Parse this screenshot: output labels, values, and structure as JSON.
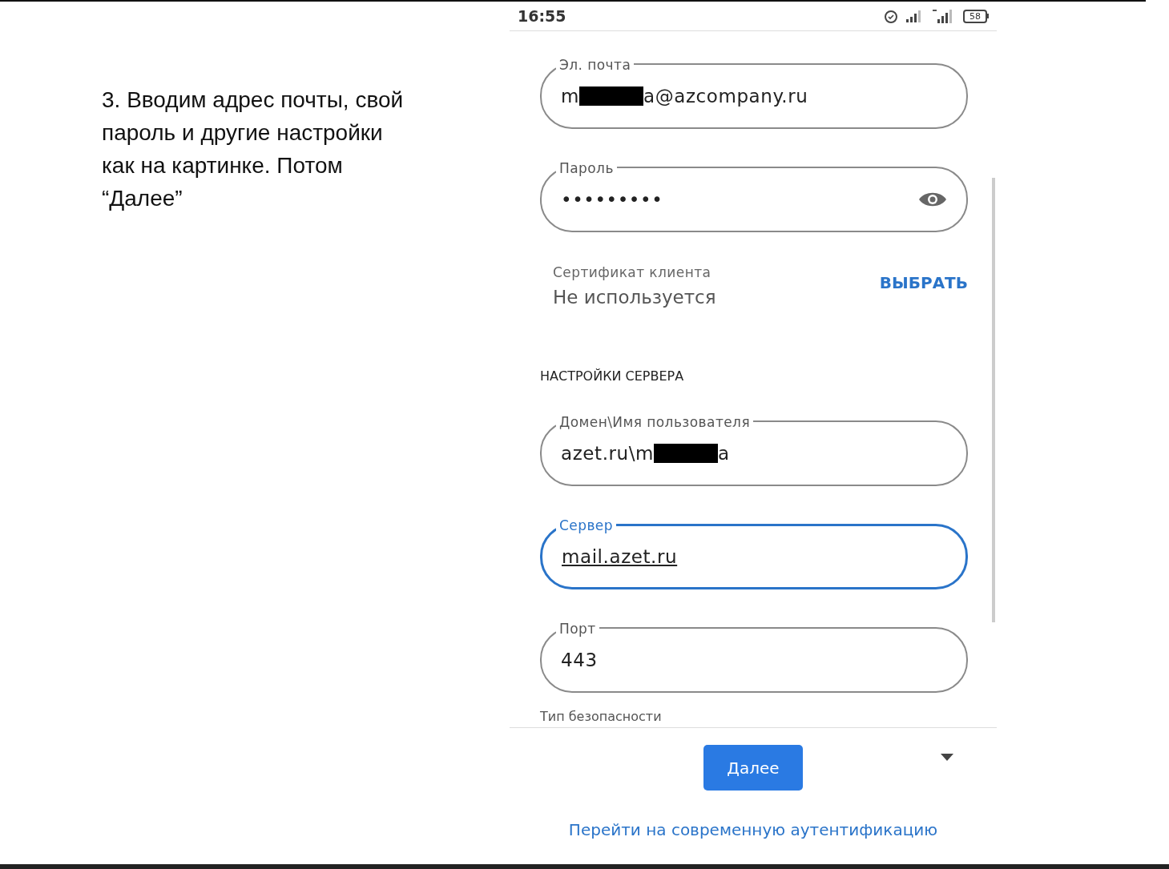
{
  "instruction": [
    "3. Вводим адрес почты, свой",
    "пароль и другие настройки",
    "как на картинке. Потом",
    "“Далее”"
  ],
  "status_bar": {
    "time": "16:55",
    "battery": "58"
  },
  "fields": [
    {
      "kind": "text",
      "label": "Эл. почта",
      "value_before": "m",
      "value_after": "a@azcompany.ru",
      "redacted": true,
      "focused": false
    },
    {
      "kind": "password",
      "label": "Пароль",
      "value_before": "•••••••••",
      "redacted": false,
      "focused": false
    }
  ],
  "certificate": {
    "label": "Сертификат клиента",
    "value": "Не используется",
    "action": "ВЫБРАТЬ"
  },
  "server_section": {
    "title": "НАСТРОЙКИ СЕРВЕРА",
    "fields": [
      {
        "kind": "text",
        "label": "Домен\\Имя пользователя",
        "value_before": "azet.ru\\m",
        "value_after": "a",
        "redacted": true,
        "focused": false
      },
      {
        "kind": "text",
        "label": "Сервер",
        "value_before": "mail.azet.ru",
        "redacted": false,
        "focused": true
      },
      {
        "kind": "text",
        "label": "Порт",
        "value_before": "443",
        "redacted": false,
        "focused": false
      }
    ],
    "next_label": "Тип безопасности"
  },
  "footer": {
    "next_button": "Далее",
    "link": "Перейти на современную аутентификацию"
  }
}
